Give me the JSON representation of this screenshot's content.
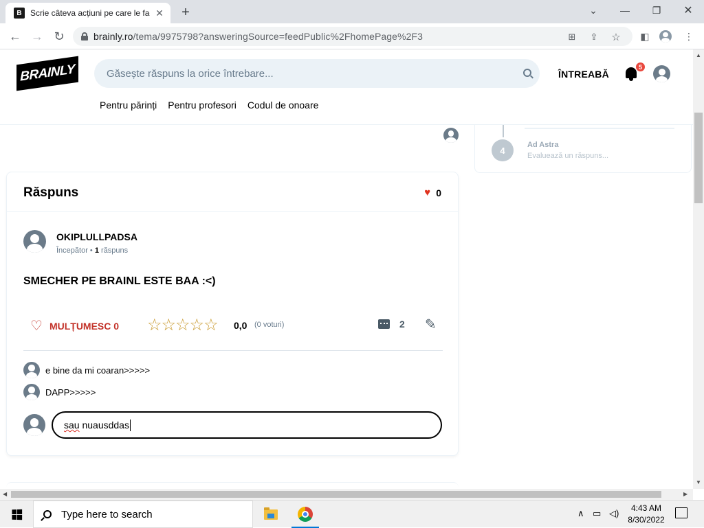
{
  "browser": {
    "tab_title": "Scrie câteva acțiuni pe care le fac",
    "tab_favicon": "B",
    "url_host": "brainly.ro",
    "url_path": "/tema/9975798?answeringSource=feedPublic%2FhomePage%2F3"
  },
  "header": {
    "logo": "BRAINLY",
    "search_placeholder": "Găsește răspuns la orice întrebare...",
    "ask_label": "ÎNTREABĂ",
    "notification_count": "5",
    "links": [
      "Pentru părinți",
      "Pentru profesori",
      "Codul de onoare"
    ]
  },
  "steps": {
    "number": "4",
    "title": "Ad Astra",
    "subtitle": "Evaluează un răspuns..."
  },
  "answer": {
    "title": "Răspuns",
    "likes": "0",
    "author": "OKIPLULLPADSA",
    "rank": "Începător",
    "answers_count": "1",
    "answers_label": "răspuns",
    "text": "SMECHER PE BRAINL ESTE BAA :<)",
    "thanks_label": "MULȚUMESC 0",
    "stars": "☆☆☆☆☆",
    "rating": 0,
    "rating_label": "0,0",
    "votes_label": "(0 voturi)",
    "comments_count": "2"
  },
  "comments": [
    {
      "text": "e bine da mi coaran>>>>>"
    },
    {
      "text": "DAPP>>>>>"
    }
  ],
  "comment_input": {
    "value_word1": "sau",
    "value_rest": " nuausddas"
  },
  "taskbar": {
    "search_placeholder": "Type here to search",
    "time": "4:43 AM",
    "date": "8/30/2022"
  },
  "colors": {
    "accent_red": "#c3332a",
    "star_gold": "#c99a2e",
    "search_bg": "#ebf2f7"
  }
}
